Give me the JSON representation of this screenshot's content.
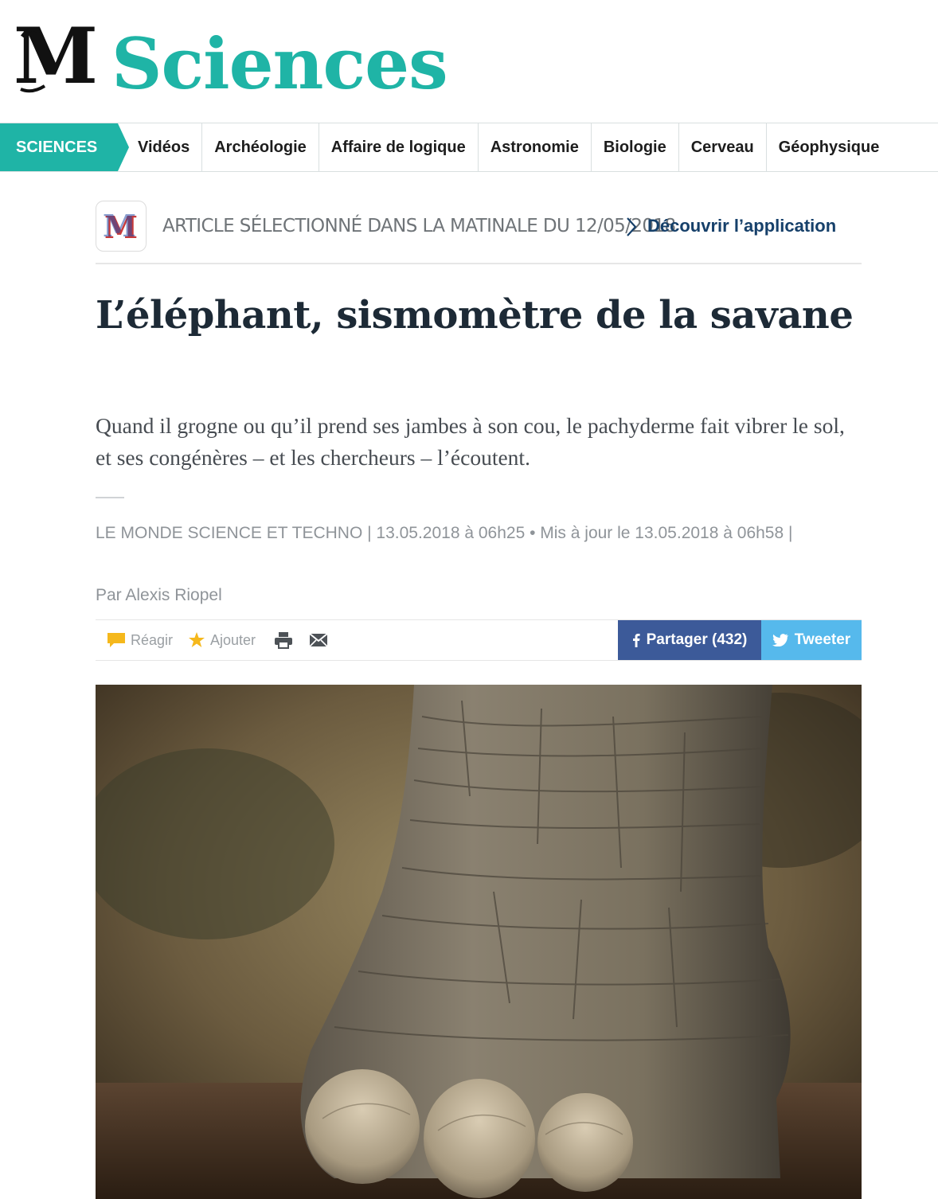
{
  "header": {
    "logo_letter": "M",
    "section_title": "Sciences"
  },
  "nav": {
    "home_label": "SCIENCES",
    "items": [
      "Vidéos",
      "Archéologie",
      "Affaire de logique",
      "Astronomie",
      "Biologie",
      "Cerveau",
      "Géophysique"
    ]
  },
  "matinale": {
    "app_icon_letter": "M",
    "text": "ARTICLE SÉLECTIONNÉ DANS LA MATINALE DU 12/05/2018",
    "link": "Découvrir l’application"
  },
  "article": {
    "title": "L’éléphant, sismomètre de la savane",
    "intro": "Quand il grogne ou qu’il prend ses jambes à son cou, le pachyderme fait vibrer le sol, et ses congénères – et les chercheurs – l’écoutent.",
    "meta": "LE MONDE SCIENCE ET TECHNO | 13.05.2018 à 06h25 • Mis à jour le 13.05.2018 à 06h58 |",
    "author": "Par Alexis Riopel"
  },
  "tools": {
    "react_label": "Réagir",
    "add_label": "Ajouter",
    "facebook_label": "Partager (432)",
    "twitter_label": "Tweeter"
  },
  "colors": {
    "brand_teal": "#1fb4a6",
    "facebook": "#3c5a99",
    "twitter": "#56b9ec",
    "link_blue": "#16406a"
  }
}
